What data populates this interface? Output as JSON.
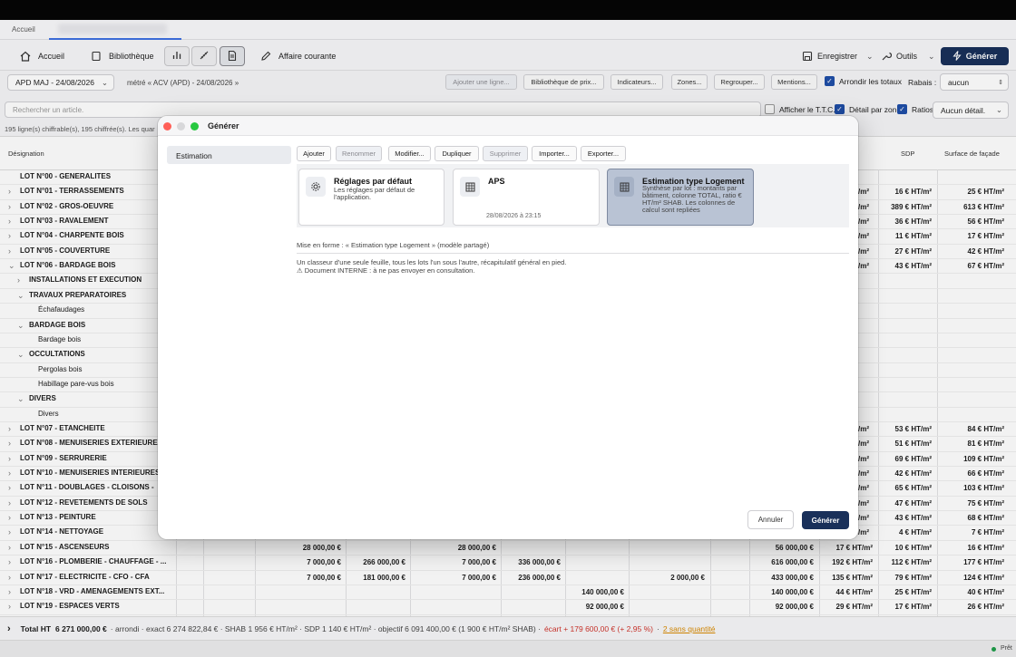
{
  "tabs": {
    "home": "Accueil"
  },
  "toolbar": {
    "accueil": "Accueil",
    "bibliotheque": "Bibliothèque",
    "affaire": "Affaire courante",
    "enregistrer": "Enregistrer",
    "outils": "Outils",
    "generer": "Générer"
  },
  "filters": {
    "version": "APD MAJ - 24/08/2026",
    "metre": "métré « ACV (APD) - 24/08/2026 »",
    "chips": [
      "Ajouter une ligne...",
      "Bibliothèque de prix...",
      "Indicateurs...",
      "Zones...",
      "Regrouper...",
      "Mentions..."
    ],
    "arrondir": "Arrondir les totaux",
    "rabais_label": "Rabais :",
    "rabais_value": "aucun",
    "afficher_ttc": "Afficher le T.T.C.",
    "detail_zone": "Détail par zone",
    "ratios": "Ratios",
    "ratio_select": "Aucun détail."
  },
  "search": {
    "placeholder": "Rechercher un article."
  },
  "countline": "195 ligne(s) chiffrable(s), 195 chiffrée(s). Les quar",
  "table": {
    "headers": {
      "designation": "Désignation",
      "sdp": "SDP",
      "facade": "Surface de façade"
    },
    "rows": [
      {
        "name": "LOT N°00 - GENERALITES",
        "level": 0,
        "chev": "",
        "partial": "",
        "sdp": "",
        "fac": ""
      },
      {
        "name": "LOT N°01 - TERRASSEMENTS",
        "level": 0,
        "chev": "›",
        "partial": "/m²",
        "sdp": "16 € HT/m²",
        "fac": "25 € HT/m²"
      },
      {
        "name": "LOT N°02 - GROS-OEUVRE",
        "level": 0,
        "chev": "›",
        "partial": "/m²",
        "sdp": "389 € HT/m²",
        "fac": "613 € HT/m²"
      },
      {
        "name": "LOT N°03 - RAVALEMENT",
        "level": 0,
        "chev": "›",
        "partial": "/m²",
        "sdp": "36 € HT/m²",
        "fac": "56 € HT/m²"
      },
      {
        "name": "LOT N°04 - CHARPENTE BOIS",
        "level": 0,
        "chev": "›",
        "partial": "/m²",
        "sdp": "11 € HT/m²",
        "fac": "17 € HT/m²"
      },
      {
        "name": "LOT N°05 - COUVERTURE",
        "level": 0,
        "chev": "›",
        "partial": "/m²",
        "sdp": "27 € HT/m²",
        "fac": "42 € HT/m²"
      },
      {
        "name": "LOT N°06 - BARDAGE BOIS",
        "level": 0,
        "chev": "⌄",
        "partial": "/m²",
        "sdp": "43 € HT/m²",
        "fac": "67 € HT/m²"
      },
      {
        "name": "INSTALLATIONS ET EXECUTION",
        "level": 1,
        "chev": "›",
        "partial": "",
        "sdp": "",
        "fac": ""
      },
      {
        "name": "TRAVAUX PREPARATOIRES",
        "level": 1,
        "chev": "⌄",
        "partial": "",
        "sdp": "",
        "fac": ""
      },
      {
        "name": "Échafaudages",
        "level": 2,
        "chev": "",
        "partial": "",
        "sdp": "",
        "fac": ""
      },
      {
        "name": "BARDAGE BOIS",
        "level": 1,
        "chev": "⌄",
        "partial": "",
        "sdp": "",
        "fac": ""
      },
      {
        "name": "Bardage bois",
        "level": 2,
        "chev": "",
        "partial": "",
        "sdp": "",
        "fac": ""
      },
      {
        "name": "OCCULTATIONS",
        "level": 1,
        "chev": "⌄",
        "partial": "",
        "sdp": "",
        "fac": ""
      },
      {
        "name": "Pergolas bois",
        "level": 2,
        "chev": "",
        "partial": "",
        "sdp": "",
        "fac": ""
      },
      {
        "name": "Habillage pare-vus bois",
        "level": 2,
        "chev": "",
        "partial": "",
        "sdp": "",
        "fac": ""
      },
      {
        "name": "DIVERS",
        "level": 1,
        "chev": "⌄",
        "partial": "",
        "sdp": "",
        "fac": ""
      },
      {
        "name": "Divers",
        "level": 2,
        "chev": "",
        "partial": "",
        "sdp": "",
        "fac": ""
      },
      {
        "name": "LOT N°07 - ETANCHEITE",
        "level": 0,
        "chev": "›",
        "partial": "/m²",
        "sdp": "53 € HT/m²",
        "fac": "84 € HT/m²"
      },
      {
        "name": "LOT N°08 - MENUISERIES EXTERIEURES",
        "level": 0,
        "chev": "›",
        "partial": "/m²",
        "sdp": "51 € HT/m²",
        "fac": "81 € HT/m²"
      },
      {
        "name": "LOT N°09 - SERRURERIE",
        "level": 0,
        "chev": "›",
        "partial": "/m²",
        "sdp": "69 € HT/m²",
        "fac": "109 € HT/m²"
      },
      {
        "name": "LOT N°10 - MENUISERIES INTERIEURES",
        "level": 0,
        "chev": "›",
        "partial": "/m²",
        "sdp": "42 € HT/m²",
        "fac": "66 € HT/m²"
      },
      {
        "name": "LOT N°11 - DOUBLAGES - CLOISONS -",
        "level": 0,
        "chev": "›",
        "partial": "/m²",
        "sdp": "65 € HT/m²",
        "fac": "103 € HT/m²"
      },
      {
        "name": "LOT N°12 - REVETEMENTS DE SOLS",
        "level": 0,
        "chev": "›",
        "partial": "/m²",
        "sdp": "47 € HT/m²",
        "fac": "75 € HT/m²"
      },
      {
        "name": "LOT N°13 - PEINTURE",
        "level": 0,
        "chev": "›",
        "partial": "/m²",
        "sdp": "43 € HT/m²",
        "fac": "68 € HT/m²"
      },
      {
        "name": "LOT N°14 - NETTOYAGE",
        "level": 0,
        "chev": "›",
        "partial": "/m²",
        "sdp": "4 € HT/m²",
        "fac": "7 € HT/m²"
      }
    ],
    "bottom_rows": [
      {
        "name": "LOT N°15 - ASCENSEURS",
        "c1": "28 000,00 €",
        "c2": "",
        "c3": "28 000,00 €",
        "c4": "",
        "c5": "",
        "c6": "",
        "total": "56 000,00 €",
        "shab": "17 € HT/m²",
        "sdp": "10 € HT/m²",
        "fac": "16 € HT/m²"
      },
      {
        "name": "LOT N°16 - PLOMBERIE - CHAUFFAGE - ...",
        "c1": "7 000,00 €",
        "c2": "266 000,00 €",
        "c3": "7 000,00 €",
        "c4": "336 000,00 €",
        "c5": "",
        "c6": "",
        "total": "616 000,00 €",
        "shab": "192 € HT/m²",
        "sdp": "112 € HT/m²",
        "fac": "177 € HT/m²"
      },
      {
        "name": "LOT N°17 - ELECTRICITE - CFO - CFA",
        "c1": "7 000,00 €",
        "c2": "181 000,00 €",
        "c3": "7 000,00 €",
        "c4": "236 000,00 €",
        "c5": "",
        "c6": "2 000,00 €",
        "total": "433 000,00 €",
        "shab": "135 € HT/m²",
        "sdp": "79 € HT/m²",
        "fac": "124 € HT/m²"
      },
      {
        "name": "LOT N°18 - VRD - AMENAGEMENTS EXT...",
        "c1": "",
        "c2": "",
        "c3": "",
        "c4": "",
        "c5": "140 000,00 €",
        "c6": "",
        "total": "140 000,00 €",
        "shab": "44 € HT/m²",
        "sdp": "25 € HT/m²",
        "fac": "40 € HT/m²"
      },
      {
        "name": "LOT N°19 - ESPACES VERTS",
        "c1": "",
        "c2": "",
        "c3": "",
        "c4": "",
        "c5": "92 000,00 €",
        "c6": "",
        "total": "92 000,00 €",
        "shab": "29 € HT/m²",
        "sdp": "17 € HT/m²",
        "fac": "26 € HT/m²"
      }
    ]
  },
  "footer": {
    "total_label": "Total HT",
    "total_value": "6 271 000,00 €",
    "details": "· arrondi · exact 6 274 822,84 € · SHAB 1 956 € HT/m² · SDP 1 140 € HT/m² · objectif 6 091 400,00 € (1 900 € HT/m² SHAB) ·",
    "ecart": "écart + 179 600,00 € (+ 2,95 %)",
    "sep": "·",
    "sans_quantite": "2 sans quantité"
  },
  "status": "Prêt",
  "dialog": {
    "title": "Générer",
    "sidebar_item": "Estimation",
    "tools": [
      "Ajouter",
      "Renommer",
      "Modifier...",
      "Dupliquer",
      "Supprimer",
      "Importer...",
      "Exporter..."
    ],
    "cards": [
      {
        "title": "Réglages par défaut",
        "desc": "Les réglages par défaut de l'application.",
        "date": ""
      },
      {
        "title": "APS",
        "desc": "",
        "date": "28/08/2026 à 23:15"
      },
      {
        "title": "Estimation type Logement",
        "desc": "Synthèse par lot : montants par bâtiment, colonne TOTAL, ratio € HT/m² SHAB. Les colonnes de calcul sont repliées",
        "date": ""
      }
    ],
    "mise_en_forme": "Mise en forme : « Estimation type Logement » (modèle partagé)",
    "desc1": "Un classeur d'une seule feuille, tous les lots l'un sous l'autre, récapitulatif général en pied.",
    "desc2": "⚠ Document INTERNE : à ne pas envoyer en consultation.",
    "cancel": "Annuler",
    "generate": "Générer"
  },
  "colors": {
    "accent": "#19305a",
    "selected_card": "#b9c3d4",
    "danger": "#d0342c",
    "warning": "#d98a00"
  }
}
